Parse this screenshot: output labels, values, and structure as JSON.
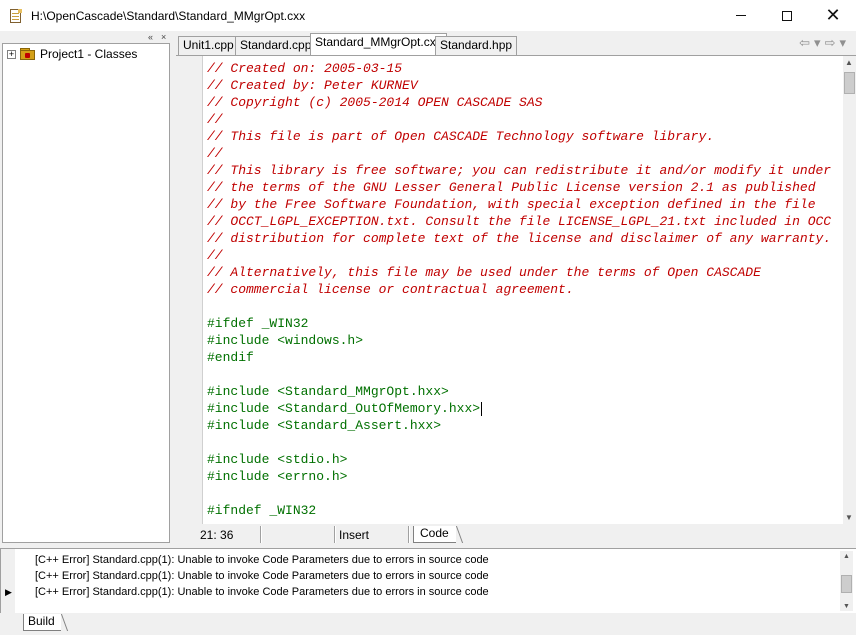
{
  "window": {
    "title": "H:\\OpenCascade\\Standard\\Standard_MMgrOpt.cxx",
    "minimize": "",
    "maximize": "",
    "close": "✕"
  },
  "tree": {
    "root_label": "Project1 - Classes",
    "expander": "+"
  },
  "tabs": [
    {
      "label": "Unit1.cpp"
    },
    {
      "label": "Standard.cpp"
    },
    {
      "label": "Standard_MMgrOpt.cxx"
    },
    {
      "label": "Standard.hpp"
    }
  ],
  "nav": {
    "back": "⇦",
    "dropdown": "▾",
    "forward": "⇨"
  },
  "code_lines": [
    "// Created on: 2005-03-15",
    "// Created by: Peter KURNEV",
    "// Copyright (c) 2005-2014 OPEN CASCADE SAS",
    "//",
    "// This file is part of Open CASCADE Technology software library.",
    "//",
    "// This library is free software; you can redistribute it and/or modify it under",
    "// the terms of the GNU Lesser General Public License version 2.1 as published",
    "// by the Free Software Foundation, with special exception defined in the file",
    "// OCCT_LGPL_EXCEPTION.txt. Consult the file LICENSE_LGPL_21.txt included in OCC",
    "// distribution for complete text of the license and disclaimer of any warranty.",
    "//",
    "// Alternatively, this file may be used under the terms of Open CASCADE",
    "// commercial license or contractual agreement.",
    "",
    "#ifdef _WIN32",
    "#include <windows.h>",
    "#endif",
    "",
    "#include <Standard_MMgrOpt.hxx>",
    "#include <Standard_OutOfMemory.hxx>",
    "#include <Standard_Assert.hxx>",
    "",
    "#include <stdio.h>",
    "#include <errno.h>",
    "",
    "#ifndef _WIN32"
  ],
  "status": {
    "position": "21:  36",
    "mode": "Insert",
    "code_tab": "Code"
  },
  "messages": [
    "[C++ Error] Standard.cpp(1): Unable to invoke Code Parameters due to errors in source code",
    "[C++ Error] Standard.cpp(1): Unable to invoke Code Parameters due to errors in source code",
    "[C++ Error] Standard.cpp(1): Unable to invoke Code Parameters due to errors in source code"
  ],
  "bottom": {
    "build_tab": "Build"
  }
}
